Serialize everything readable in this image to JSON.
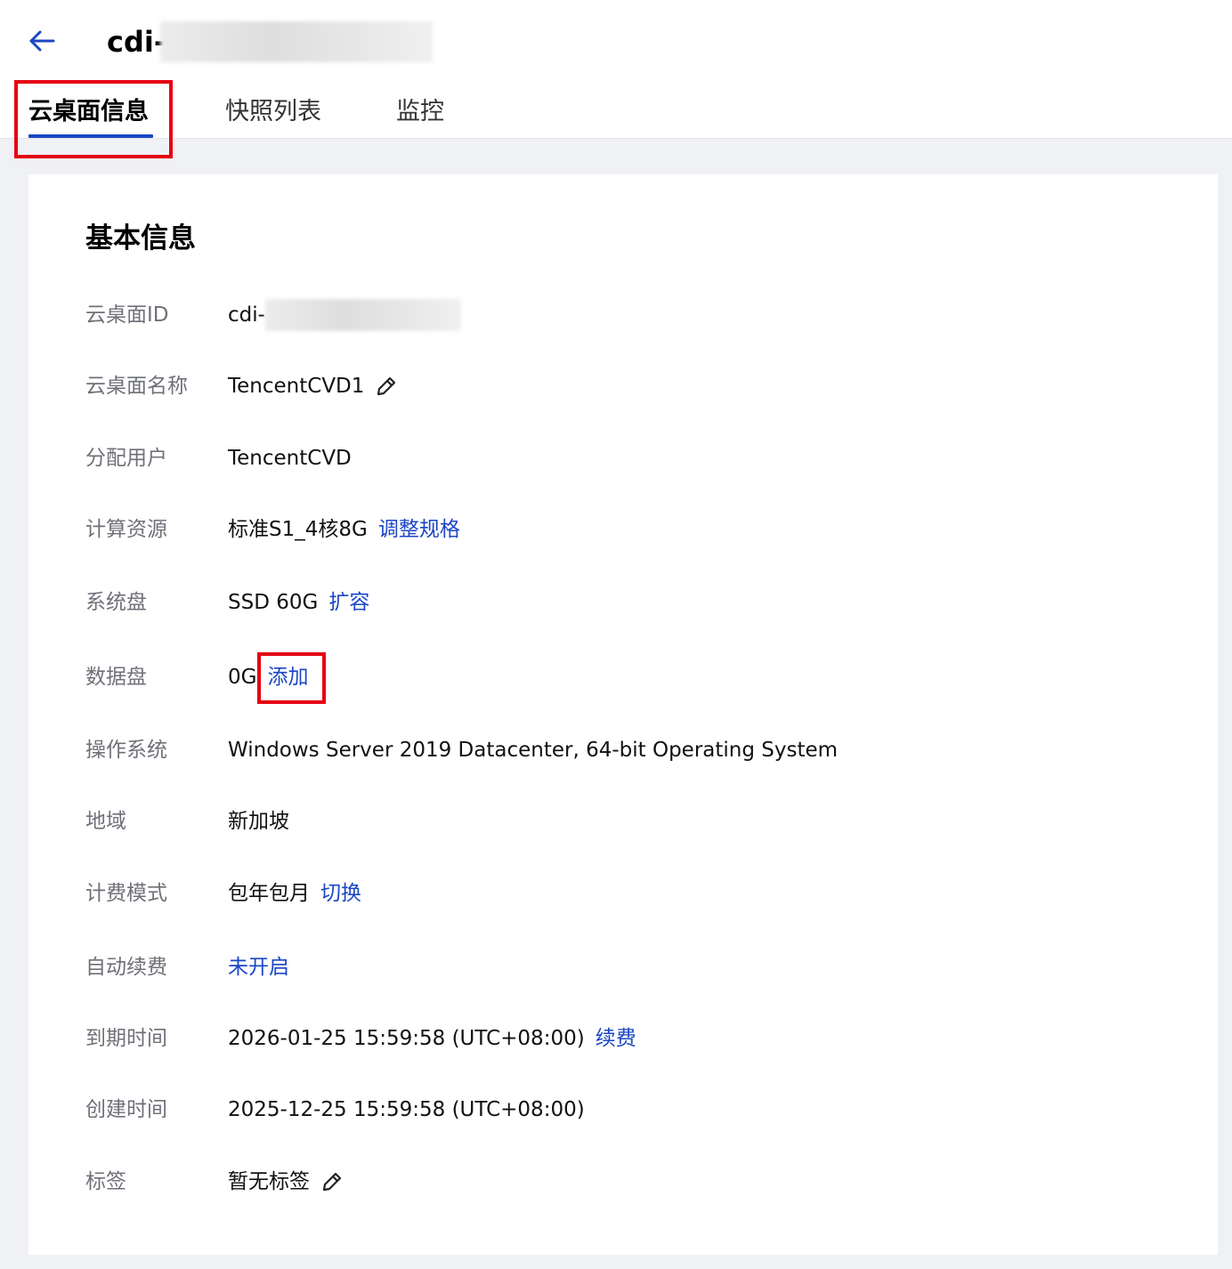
{
  "header": {
    "title_prefix": "cdi-"
  },
  "tabs": [
    {
      "label": "云桌面信息",
      "active": true
    },
    {
      "label": "快照列表",
      "active": false
    },
    {
      "label": "监控",
      "active": false
    }
  ],
  "section": {
    "title": "基本信息"
  },
  "info": {
    "id": {
      "label": "云桌面ID",
      "value": "cdi-"
    },
    "name": {
      "label": "云桌面名称",
      "value": "TencentCVD1"
    },
    "user": {
      "label": "分配用户",
      "value": "TencentCVD"
    },
    "compute": {
      "label": "计算资源",
      "value": "标准S1_4核8G",
      "action": "调整规格"
    },
    "system_disk": {
      "label": "系统盘",
      "value": "SSD 60G",
      "action": "扩容"
    },
    "data_disk": {
      "label": "数据盘",
      "value": "0G",
      "action": "添加"
    },
    "os": {
      "label": "操作系统",
      "value": "Windows Server 2019 Datacenter, 64-bit Operating System"
    },
    "region": {
      "label": "地域",
      "value": "新加坡"
    },
    "billing": {
      "label": "计费模式",
      "value": "包年包月",
      "action": "切换"
    },
    "auto_renew": {
      "label": "自动续费",
      "action": "未开启"
    },
    "expire": {
      "label": "到期时间",
      "value": "2026-01-25 15:59:58 (UTC+08:00)",
      "action": "续费"
    },
    "created": {
      "label": "创建时间",
      "value": "2025-12-25 15:59:58 (UTC+08:00)"
    },
    "tags": {
      "label": "标签",
      "value": "暂无标签"
    }
  },
  "icons": {
    "back": "arrow-left-icon",
    "edit": "pencil-icon"
  },
  "colors": {
    "accent": "#1b46c4",
    "highlight": "#e50012",
    "label": "#6f7178",
    "page_bg": "#f0f1f5"
  }
}
